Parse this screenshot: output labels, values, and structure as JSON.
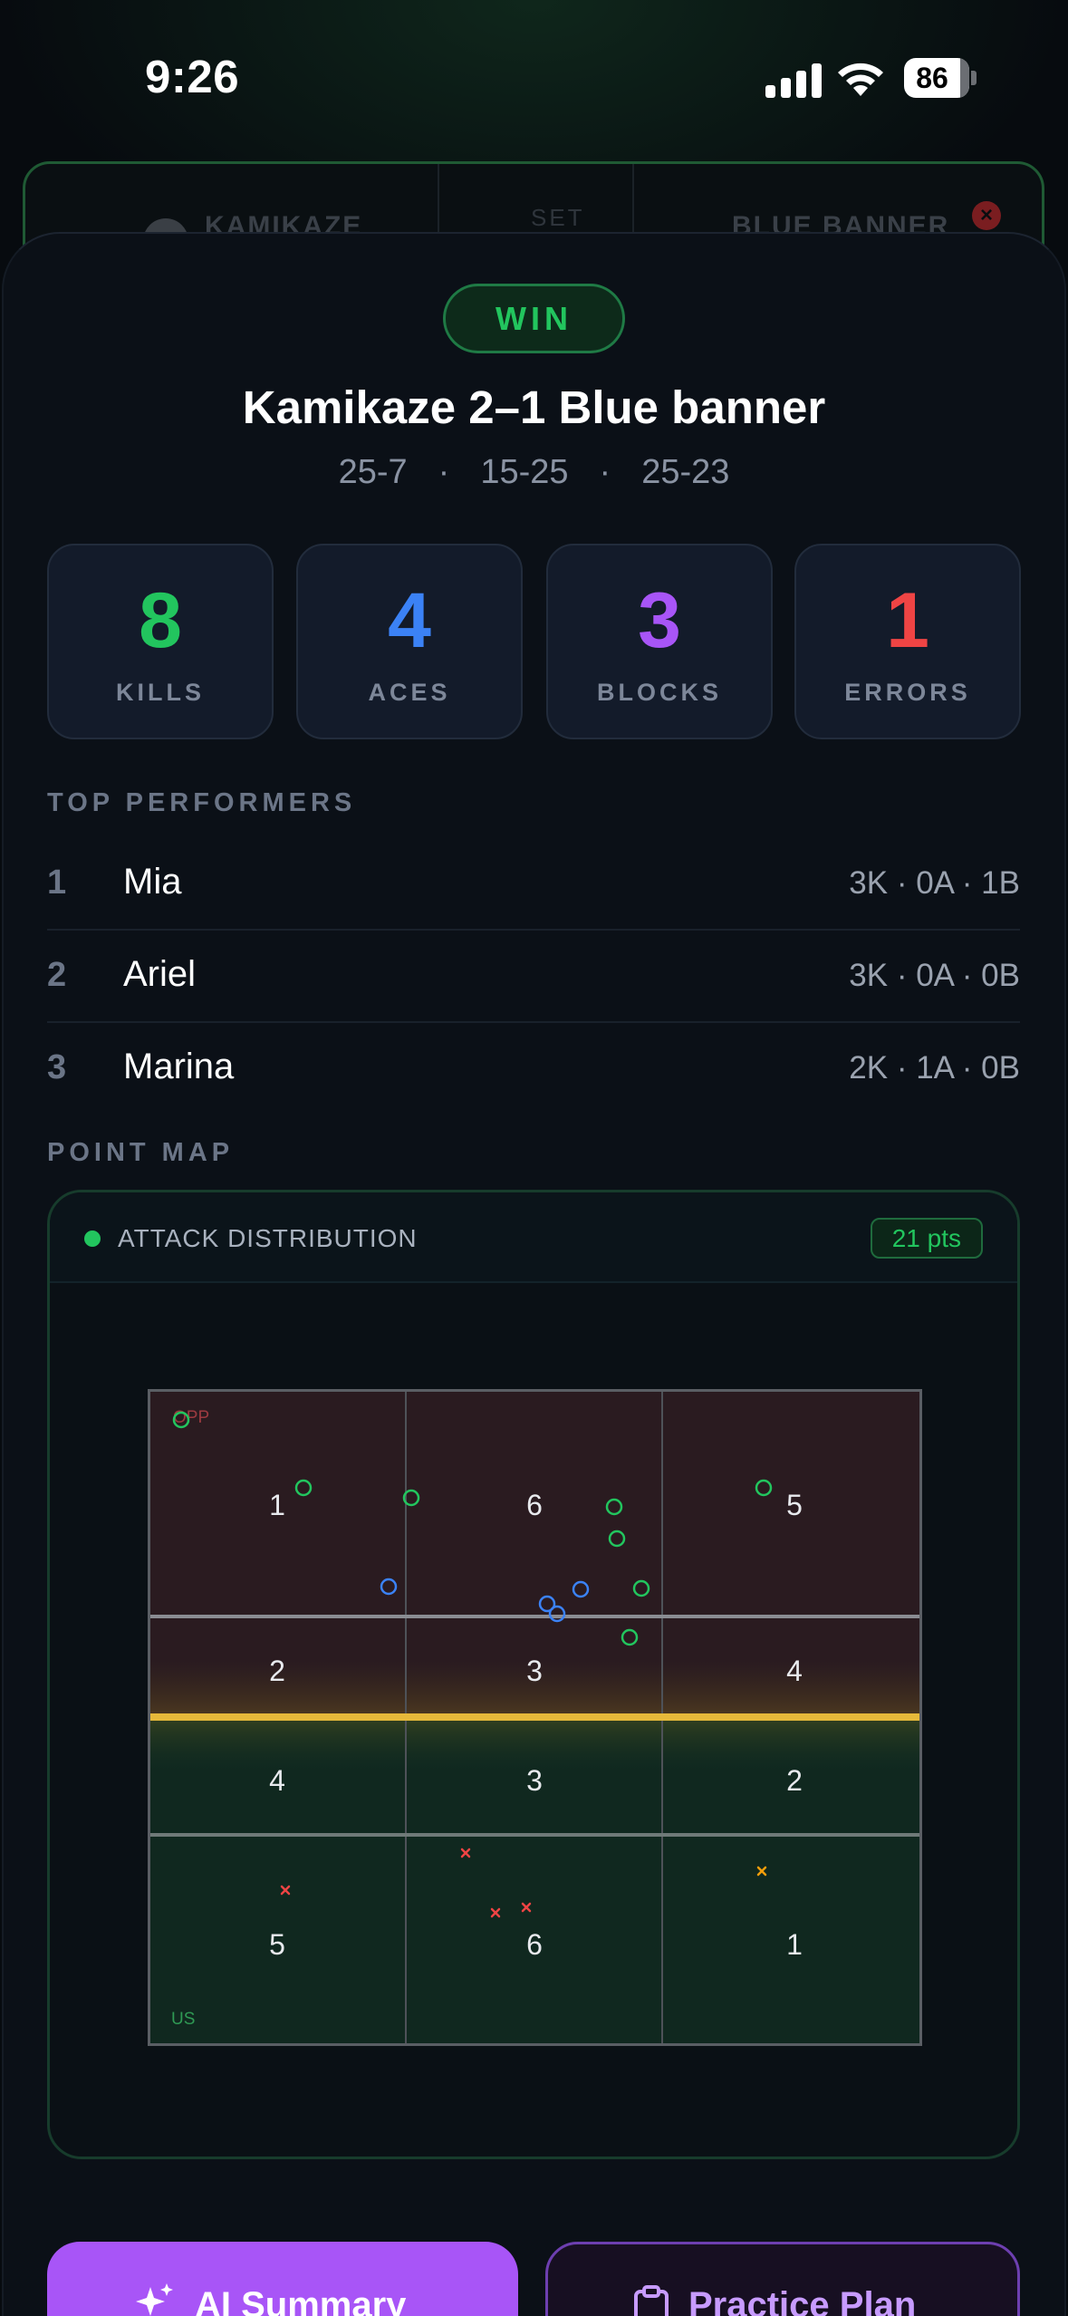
{
  "status_bar": {
    "time": "9:26",
    "battery": "86"
  },
  "background_card": {
    "team_left": "KAMIKAZE",
    "set_label": "SET",
    "team_right": "BLUE BANNER"
  },
  "result": {
    "badge": "WIN",
    "title": "Kamikaze 2–1 Blue banner",
    "sets": [
      "25-7",
      "15-25",
      "25-23"
    ],
    "separator": "·"
  },
  "stats": [
    {
      "value": "8",
      "label": "KILLS",
      "color": "#22c55e"
    },
    {
      "value": "4",
      "label": "ACES",
      "color": "#3b82f6"
    },
    {
      "value": "3",
      "label": "BLOCKS",
      "color": "#a855f7"
    },
    {
      "value": "1",
      "label": "ERRORS",
      "color": "#ef4444"
    }
  ],
  "top_performers": {
    "heading": "TOP PERFORMERS",
    "rows": [
      {
        "rank": "1",
        "name": "Mia",
        "stats": "3K · 0A · 1B"
      },
      {
        "rank": "2",
        "name": "Ariel",
        "stats": "3K · 0A · 0B"
      },
      {
        "rank": "3",
        "name": "Marina",
        "stats": "2K · 1A · 0B"
      }
    ]
  },
  "point_map": {
    "heading": "POINT MAP",
    "card_title": "ATTACK DISTRIBUTION",
    "points_badge": "21 pts",
    "opp_label": "OPP",
    "us_label": "US",
    "opp_zones": [
      [
        "1",
        "6",
        "5"
      ],
      [
        "2",
        "3",
        "4"
      ]
    ],
    "us_zones": [
      [
        "4",
        "3",
        "2"
      ],
      [
        "5",
        "6",
        "1"
      ]
    ]
  },
  "actions": {
    "ai_summary": "AI Summary",
    "practice_plan": "Practice Plan"
  }
}
